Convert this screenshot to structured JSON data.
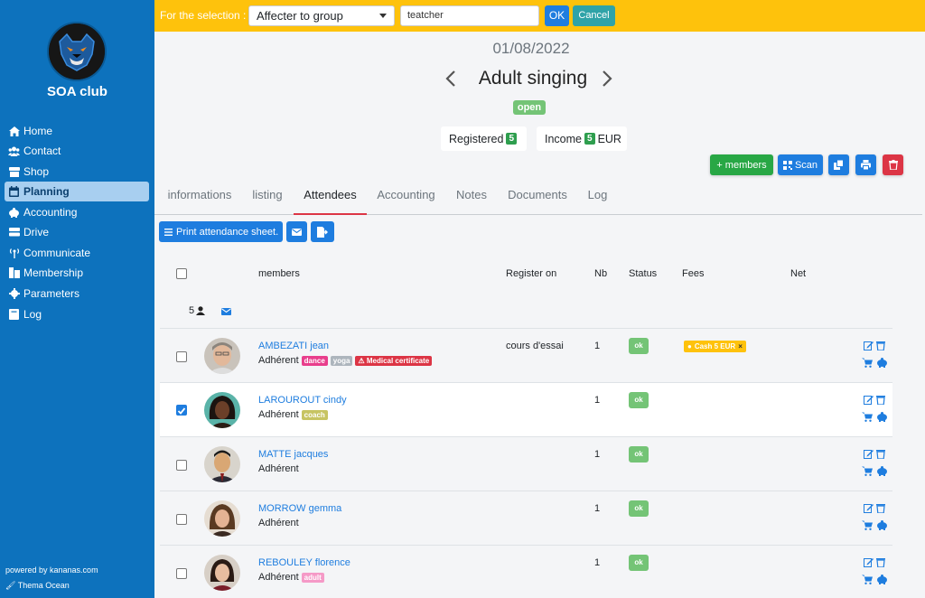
{
  "sidebar": {
    "club_name": "SOA club",
    "items": [
      {
        "label": "Home",
        "icon": "home-icon"
      },
      {
        "label": "Contact",
        "icon": "users-icon"
      },
      {
        "label": "Shop",
        "icon": "shop-icon"
      },
      {
        "label": "Planning",
        "icon": "calendar-icon",
        "active": true
      },
      {
        "label": "Accounting",
        "icon": "piggy-bank-icon"
      },
      {
        "label": "Drive",
        "icon": "drive-icon"
      },
      {
        "label": "Communicate",
        "icon": "broadcast-icon"
      },
      {
        "label": "Membership",
        "icon": "membership-icon"
      },
      {
        "label": "Parameters",
        "icon": "gear-icon"
      },
      {
        "label": "Log",
        "icon": "book-icon"
      }
    ],
    "powered_by": "powered by kananas.com",
    "theme": "Thema Ocean"
  },
  "selection_bar": {
    "label": "For the selection :",
    "action_value": "Affecter to group",
    "group_value": "teatcher",
    "ok_label": "OK",
    "cancel_label": "Cancel"
  },
  "event": {
    "date": "01/08/2022",
    "title": "Adult singing",
    "status": "open",
    "registered_label": "Registered",
    "registered_count": "5",
    "income_label": "Income",
    "income_value": "5",
    "income_currency": "EUR"
  },
  "actions": {
    "add_members_label": "+ members",
    "scan_label": "Scan"
  },
  "tabs": [
    "informations",
    "listing",
    "Attendees",
    "Accounting",
    "Notes",
    "Documents",
    "Log"
  ],
  "active_tab": "Attendees",
  "toolbar": {
    "print_sheet_label": "Print attendance sheet."
  },
  "table": {
    "headers": {
      "members": "members",
      "register_on": "Register on",
      "nb": "Nb",
      "status": "Status",
      "fees": "Fees",
      "net": "Net"
    },
    "member_count": "5",
    "rows": [
      {
        "name": "AMBEZATI jean",
        "type": "Adhérent",
        "tags": [
          {
            "text": "dance",
            "color": "#e83e8c"
          },
          {
            "text": "yoga",
            "color": "#adb5bd"
          },
          {
            "text": "Medical certificate",
            "color": "#dc3545"
          }
        ],
        "register_on": "cours d'essai",
        "nb": "1",
        "status": "ok",
        "fee": "Cash 5 EUR",
        "fee_remove": "×",
        "checked": false
      },
      {
        "name": "LAROUROUT cindy",
        "type": "Adhérent",
        "tags": [
          {
            "text": "coach",
            "color": "#c7c462"
          }
        ],
        "register_on": "",
        "nb": "1",
        "status": "ok",
        "fee": "",
        "checked": true
      },
      {
        "name": "MATTE jacques",
        "type": "Adhérent",
        "tags": [],
        "register_on": "",
        "nb": "1",
        "status": "ok",
        "fee": "",
        "checked": false
      },
      {
        "name": "MORROW gemma",
        "type": "Adhérent",
        "tags": [],
        "register_on": "",
        "nb": "1",
        "status": "ok",
        "fee": "",
        "checked": false
      },
      {
        "name": "REBOULEY florence",
        "type": "Adhérent",
        "tags": [
          {
            "text": "adult",
            "color": "#f59ac7"
          }
        ],
        "register_on": "",
        "nb": "1",
        "status": "ok",
        "fee": "",
        "checked": false
      }
    ]
  },
  "colors": {
    "sidebar": "#0d72bd",
    "topbar": "#fec20c",
    "primary": "#1e7ddf",
    "success": "#28a745",
    "danger": "#dc3545",
    "status_ok": "#74c476"
  }
}
